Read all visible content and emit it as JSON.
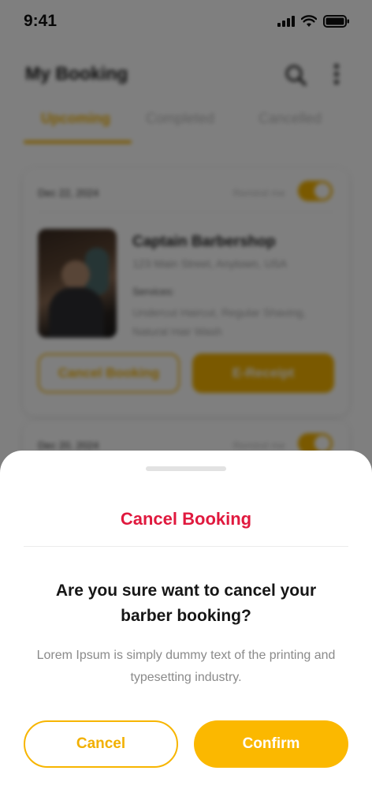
{
  "status_bar": {
    "time": "9:41",
    "icons": [
      "signal-icon",
      "wifi-icon",
      "battery-icon"
    ]
  },
  "header": {
    "title": "My Booking",
    "icons": [
      "search-icon",
      "more-vertical-icon"
    ]
  },
  "tabs": [
    {
      "label": "Upcoming",
      "active": true
    },
    {
      "label": "Completed",
      "active": false
    },
    {
      "label": "Cancelled",
      "active": false
    }
  ],
  "bookings": [
    {
      "date": "Dec 22, 2024",
      "remind_label": "Remind me",
      "remind_on": true,
      "shop_name": "Captain Barbershop",
      "address": "123 Main Street, Anytown, USA",
      "services_label": "Services:",
      "services": "Undercut Haircut, Regular Shaving, Natural Hair Wash",
      "cancel_label": "Cancel Booking",
      "receipt_label": "E-Receipt"
    },
    {
      "date": "Dec 20, 2024",
      "remind_label": "Remind me",
      "remind_on": true
    }
  ],
  "sheet": {
    "title": "Cancel Booking",
    "question": "Are you sure want to cancel your barber booking?",
    "description": "Lorem Ipsum is simply dummy text of the printing and typesetting industry.",
    "cancel_label": "Cancel",
    "confirm_label": "Confirm"
  },
  "colors": {
    "accent": "#fbb800",
    "danger": "#e0193e",
    "overlay": "rgba(0,0,0,0.50)"
  }
}
